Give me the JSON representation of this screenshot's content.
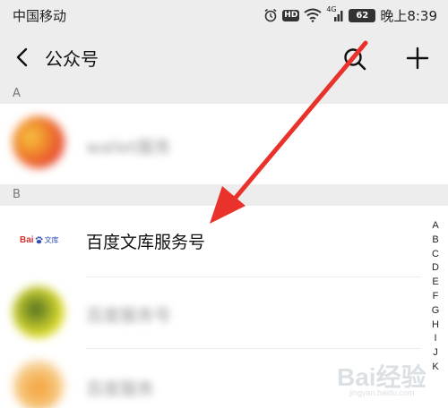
{
  "status_bar": {
    "carrier": "中国移动",
    "hd": "HD",
    "network": "4G",
    "battery": "62",
    "time": "晚上8:39"
  },
  "nav": {
    "title": "公众号"
  },
  "sections": [
    {
      "letter": "A"
    },
    {
      "letter": "B"
    }
  ],
  "rows": [
    {
      "label": "wallet服务",
      "blurred": true
    },
    {
      "label": "百度文库服务号",
      "blurred": false
    },
    {
      "label": "百度服务号",
      "blurred": true
    },
    {
      "label": "百度服务",
      "blurred": true
    }
  ],
  "baidu_logo": {
    "bai": "Bai",
    "wenku": "文库"
  },
  "index_letters": [
    "A",
    "B",
    "C",
    "D",
    "E",
    "F",
    "G",
    "H",
    "I",
    "J",
    "K"
  ],
  "watermark": {
    "brand": "Bai经验",
    "url": "jingyan.baidu.com"
  },
  "colors": {
    "arrow": "#e8322b",
    "header_bg": "#ededed"
  }
}
